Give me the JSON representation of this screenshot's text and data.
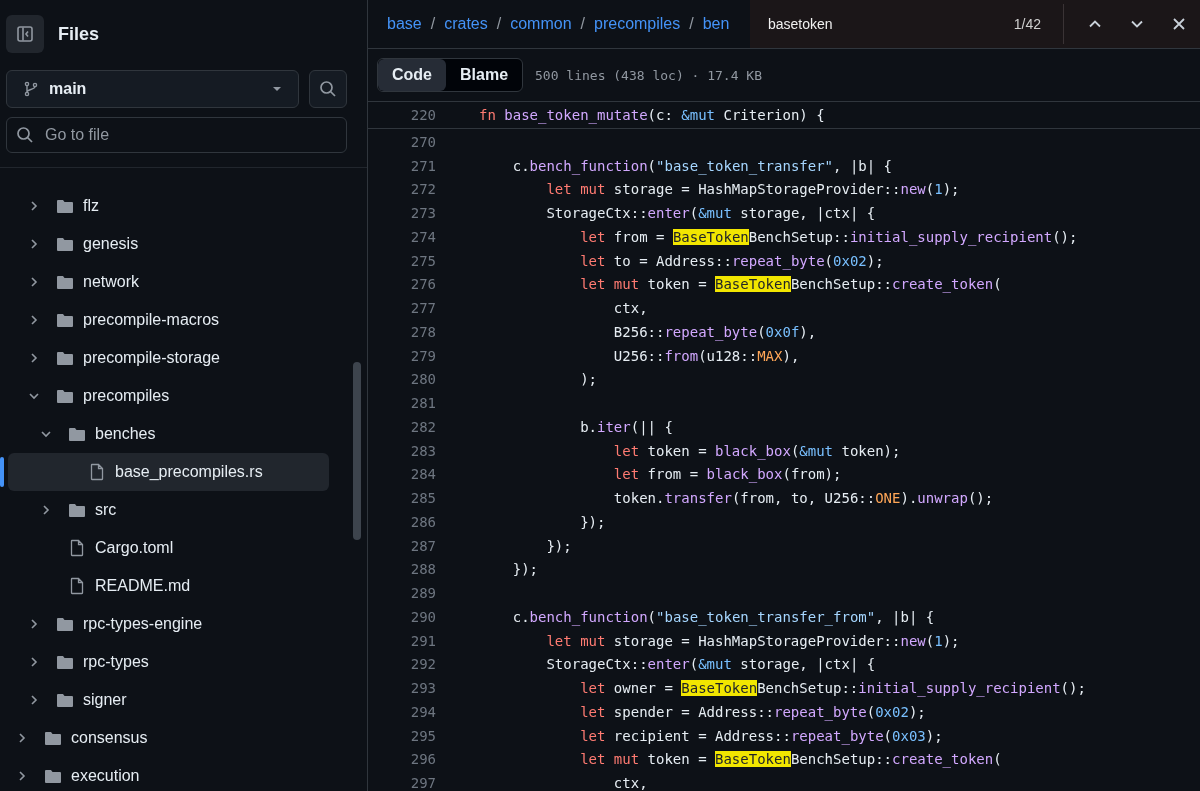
{
  "sidebar": {
    "title": "Files",
    "branch": "main",
    "go_to_file": {
      "placeholder": "Go to file"
    },
    "tree": [
      {
        "name": "flz",
        "kind": "folder",
        "expanded": false,
        "selected": false
      },
      {
        "name": "genesis",
        "kind": "folder",
        "expanded": false,
        "selected": false
      },
      {
        "name": "network",
        "kind": "folder",
        "expanded": false,
        "selected": false
      },
      {
        "name": "precompile-macros",
        "kind": "folder",
        "expanded": false,
        "selected": false
      },
      {
        "name": "precompile-storage",
        "kind": "folder",
        "expanded": false,
        "selected": false
      },
      {
        "name": "precompiles",
        "kind": "folder",
        "expanded": true,
        "selected": false,
        "children": [
          {
            "name": "benches",
            "kind": "folder",
            "expanded": true,
            "selected": false,
            "children": [
              {
                "name": "base_precompiles.rs",
                "kind": "file",
                "selected": true
              }
            ]
          },
          {
            "name": "src",
            "kind": "folder",
            "expanded": false,
            "selected": false
          },
          {
            "name": "Cargo.toml",
            "kind": "file",
            "selected": false
          },
          {
            "name": "README.md",
            "kind": "file",
            "selected": false
          }
        ]
      },
      {
        "name": "rpc-types-engine",
        "kind": "folder",
        "expanded": false,
        "selected": false
      },
      {
        "name": "rpc-types",
        "kind": "folder",
        "expanded": false,
        "selected": false
      },
      {
        "name": "signer",
        "kind": "folder",
        "expanded": false,
        "selected": false
      }
    ],
    "root_items": [
      {
        "name": "consensus",
        "kind": "folder",
        "expanded": false,
        "selected": false
      },
      {
        "name": "execution",
        "kind": "folder",
        "expanded": false,
        "selected": false
      }
    ]
  },
  "breadcrumb": {
    "separator": "/",
    "items": [
      "base",
      "crates",
      "common",
      "precompiles",
      "ben"
    ]
  },
  "find_bar": {
    "value": "basetoken",
    "count": "1/42"
  },
  "tabs": [
    {
      "label": "Code",
      "selected": true
    },
    {
      "label": "Blame",
      "selected": false
    }
  ],
  "file_info": "500 lines (438 loc) · 17.4 KB",
  "sticky_line": {
    "number": "220",
    "tokens": [
      {
        "text": "fn ",
        "kind": "kw"
      },
      {
        "text": "base_token_mutate",
        "kind": "fn"
      },
      {
        "text": "(c: ",
        "kind": "plain"
      },
      {
        "text": "&mut",
        "kind": "ref"
      },
      {
        "text": " Criterion) {",
        "kind": "plain"
      }
    ]
  },
  "lines": [
    {
      "number": "270"
    },
    {
      "number": "271",
      "tokens": [
        {
          "text": "    c.",
          "kind": "plain"
        },
        {
          "text": "bench_function",
          "kind": "fn"
        },
        {
          "text": "(",
          "kind": "plain"
        },
        {
          "text": "\"base_token_transfer\"",
          "kind": "str"
        },
        {
          "text": ", |b| {",
          "kind": "plain"
        }
      ]
    },
    {
      "number": "272",
      "tokens": [
        {
          "text": "        let mut",
          "kind": "kw"
        },
        {
          "text": " storage = HashMapStorageProvider::",
          "kind": "plain"
        },
        {
          "text": "new",
          "kind": "fn"
        },
        {
          "text": "(",
          "kind": "plain"
        },
        {
          "text": "1",
          "kind": "num"
        },
        {
          "text": ");",
          "kind": "plain"
        }
      ]
    },
    {
      "number": "273",
      "tokens": [
        {
          "text": "        StorageCtx::",
          "kind": "plain"
        },
        {
          "text": "enter",
          "kind": "fn"
        },
        {
          "text": "(",
          "kind": "plain"
        },
        {
          "text": "&mut",
          "kind": "ref"
        },
        {
          "text": " storage, |ctx| {",
          "kind": "plain"
        }
      ]
    },
    {
      "number": "274",
      "tokens": [
        {
          "text": "            let",
          "kind": "kw"
        },
        {
          "text": " from = ",
          "kind": "plain"
        },
        {
          "text": "BaseToken",
          "kind": "match"
        },
        {
          "text": "BenchSetup::",
          "kind": "plain"
        },
        {
          "text": "initial_supply_recipient",
          "kind": "fn"
        },
        {
          "text": "();",
          "kind": "plain"
        }
      ]
    },
    {
      "number": "275",
      "tokens": [
        {
          "text": "            let",
          "kind": "kw"
        },
        {
          "text": " to = Address::",
          "kind": "plain"
        },
        {
          "text": "repeat_byte",
          "kind": "fn"
        },
        {
          "text": "(",
          "kind": "plain"
        },
        {
          "text": "0x02",
          "kind": "num"
        },
        {
          "text": ");",
          "kind": "plain"
        }
      ]
    },
    {
      "number": "276",
      "tokens": [
        {
          "text": "            let mut",
          "kind": "kw"
        },
        {
          "text": " token = ",
          "kind": "plain"
        },
        {
          "text": "BaseToken",
          "kind": "match"
        },
        {
          "text": "BenchSetup::",
          "kind": "plain"
        },
        {
          "text": "create_token",
          "kind": "fn"
        },
        {
          "text": "(",
          "kind": "plain"
        }
      ]
    },
    {
      "number": "277",
      "tokens": [
        {
          "text": "                ctx,",
          "kind": "plain"
        }
      ]
    },
    {
      "number": "278",
      "tokens": [
        {
          "text": "                B256::",
          "kind": "plain"
        },
        {
          "text": "repeat_byte",
          "kind": "fn"
        },
        {
          "text": "(",
          "kind": "plain"
        },
        {
          "text": "0x0f",
          "kind": "num"
        },
        {
          "text": "),",
          "kind": "plain"
        }
      ]
    },
    {
      "number": "279",
      "tokens": [
        {
          "text": "                U256::",
          "kind": "plain"
        },
        {
          "text": "from",
          "kind": "fn"
        },
        {
          "text": "(u128::",
          "kind": "plain"
        },
        {
          "text": "MAX",
          "kind": "const"
        },
        {
          "text": "),",
          "kind": "plain"
        }
      ]
    },
    {
      "number": "280",
      "tokens": [
        {
          "text": "            );",
          "kind": "plain"
        }
      ]
    },
    {
      "number": "281"
    },
    {
      "number": "282",
      "tokens": [
        {
          "text": "            b.",
          "kind": "plain"
        },
        {
          "text": "iter",
          "kind": "fn"
        },
        {
          "text": "(|| {",
          "kind": "plain"
        }
      ]
    },
    {
      "number": "283",
      "tokens": [
        {
          "text": "                let",
          "kind": "kw"
        },
        {
          "text": " token = ",
          "kind": "plain"
        },
        {
          "text": "black_box",
          "kind": "fn"
        },
        {
          "text": "(",
          "kind": "plain"
        },
        {
          "text": "&mut",
          "kind": "ref"
        },
        {
          "text": " token);",
          "kind": "plain"
        }
      ]
    },
    {
      "number": "284",
      "tokens": [
        {
          "text": "                let",
          "kind": "kw"
        },
        {
          "text": " from = ",
          "kind": "plain"
        },
        {
          "text": "black_box",
          "kind": "fn"
        },
        {
          "text": "(from);",
          "kind": "plain"
        }
      ]
    },
    {
      "number": "285",
      "tokens": [
        {
          "text": "                token.",
          "kind": "plain"
        },
        {
          "text": "transfer",
          "kind": "fn"
        },
        {
          "text": "(from, to, U256::",
          "kind": "plain"
        },
        {
          "text": "ONE",
          "kind": "const"
        },
        {
          "text": ").",
          "kind": "plain"
        },
        {
          "text": "unwrap",
          "kind": "fn"
        },
        {
          "text": "();",
          "kind": "plain"
        }
      ]
    },
    {
      "number": "286",
      "tokens": [
        {
          "text": "            });",
          "kind": "plain"
        }
      ]
    },
    {
      "number": "287",
      "tokens": [
        {
          "text": "        });",
          "kind": "plain"
        }
      ]
    },
    {
      "number": "288",
      "tokens": [
        {
          "text": "    });",
          "kind": "plain"
        }
      ]
    },
    {
      "number": "289"
    },
    {
      "number": "290",
      "tokens": [
        {
          "text": "    c.",
          "kind": "plain"
        },
        {
          "text": "bench_function",
          "kind": "fn"
        },
        {
          "text": "(",
          "kind": "plain"
        },
        {
          "text": "\"base_token_transfer_from\"",
          "kind": "str"
        },
        {
          "text": ", |b| {",
          "kind": "plain"
        }
      ]
    },
    {
      "number": "291",
      "tokens": [
        {
          "text": "        let mut",
          "kind": "kw"
        },
        {
          "text": " storage = HashMapStorageProvider::",
          "kind": "plain"
        },
        {
          "text": "new",
          "kind": "fn"
        },
        {
          "text": "(",
          "kind": "plain"
        },
        {
          "text": "1",
          "kind": "num"
        },
        {
          "text": ");",
          "kind": "plain"
        }
      ]
    },
    {
      "number": "292",
      "tokens": [
        {
          "text": "        StorageCtx::",
          "kind": "plain"
        },
        {
          "text": "enter",
          "kind": "fn"
        },
        {
          "text": "(",
          "kind": "plain"
        },
        {
          "text": "&mut",
          "kind": "ref"
        },
        {
          "text": " storage, |ctx| {",
          "kind": "plain"
        }
      ]
    },
    {
      "number": "293",
      "tokens": [
        {
          "text": "            let",
          "kind": "kw"
        },
        {
          "text": " owner = ",
          "kind": "plain"
        },
        {
          "text": "BaseToken",
          "kind": "match"
        },
        {
          "text": "BenchSetup::",
          "kind": "plain"
        },
        {
          "text": "initial_supply_recipient",
          "kind": "fn"
        },
        {
          "text": "();",
          "kind": "plain"
        }
      ]
    },
    {
      "number": "294",
      "tokens": [
        {
          "text": "            let",
          "kind": "kw"
        },
        {
          "text": " spender = Address::",
          "kind": "plain"
        },
        {
          "text": "repeat_byte",
          "kind": "fn"
        },
        {
          "text": "(",
          "kind": "plain"
        },
        {
          "text": "0x02",
          "kind": "num"
        },
        {
          "text": ");",
          "kind": "plain"
        }
      ]
    },
    {
      "number": "295",
      "tokens": [
        {
          "text": "            let",
          "kind": "kw"
        },
        {
          "text": " recipient = Address::",
          "kind": "plain"
        },
        {
          "text": "repeat_byte",
          "kind": "fn"
        },
        {
          "text": "(",
          "kind": "plain"
        },
        {
          "text": "0x03",
          "kind": "num"
        },
        {
          "text": ");",
          "kind": "plain"
        }
      ]
    },
    {
      "number": "296",
      "tokens": [
        {
          "text": "            let mut",
          "kind": "kw"
        },
        {
          "text": " token = ",
          "kind": "plain"
        },
        {
          "text": "BaseToken",
          "kind": "match"
        },
        {
          "text": "BenchSetup::",
          "kind": "plain"
        },
        {
          "text": "create_token",
          "kind": "fn"
        },
        {
          "text": "(",
          "kind": "plain"
        }
      ]
    },
    {
      "number": "297",
      "tokens": [
        {
          "text": "                ctx,",
          "kind": "plain"
        }
      ]
    }
  ]
}
